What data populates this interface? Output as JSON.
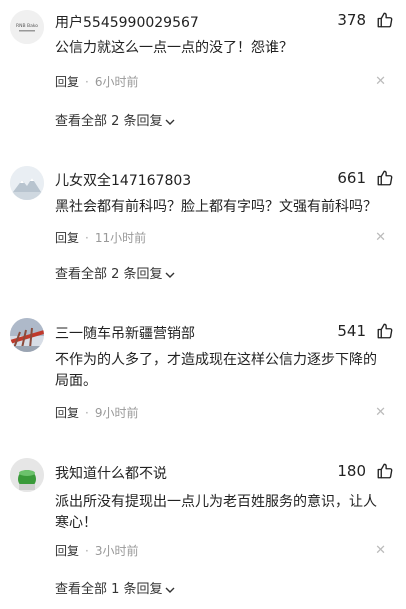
{
  "comments": [
    {
      "username": "用户5545990029567",
      "likes": "378",
      "text": "公信力就这么一点一点的没了！怨谁？",
      "reply_label": "回复",
      "time": "6小时前",
      "view_all": "查看全部 2 条回复",
      "avatar_text": "RNB Bako"
    },
    {
      "username": "儿女双全147167803",
      "likes": "661",
      "text": "黑社会都有前科吗？脸上都有字吗？文强有前科吗？",
      "reply_label": "回复",
      "time": "11小时前",
      "view_all": "查看全部 2 条回复"
    },
    {
      "username": "三一随车吊新疆营销部",
      "likes": "541",
      "text": "不作为的人多了，才造成现在这样公信力逐步下降的局面。",
      "reply_label": "回复",
      "time": "9小时前"
    },
    {
      "username": "我知道什么都不说",
      "likes": "180",
      "text": "派出所没有提现出一点儿为老百姓服务的意识，让人寒心！",
      "reply_label": "回复",
      "time": "3小时前",
      "view_all": "查看全部 1 条回复"
    }
  ],
  "icons": {
    "like": "thumbs-up-icon",
    "close": "close-icon",
    "expand": "chevron-down-icon"
  },
  "colors": {
    "text": "#222222",
    "muted": "#999999",
    "close": "#bbbbbb"
  }
}
